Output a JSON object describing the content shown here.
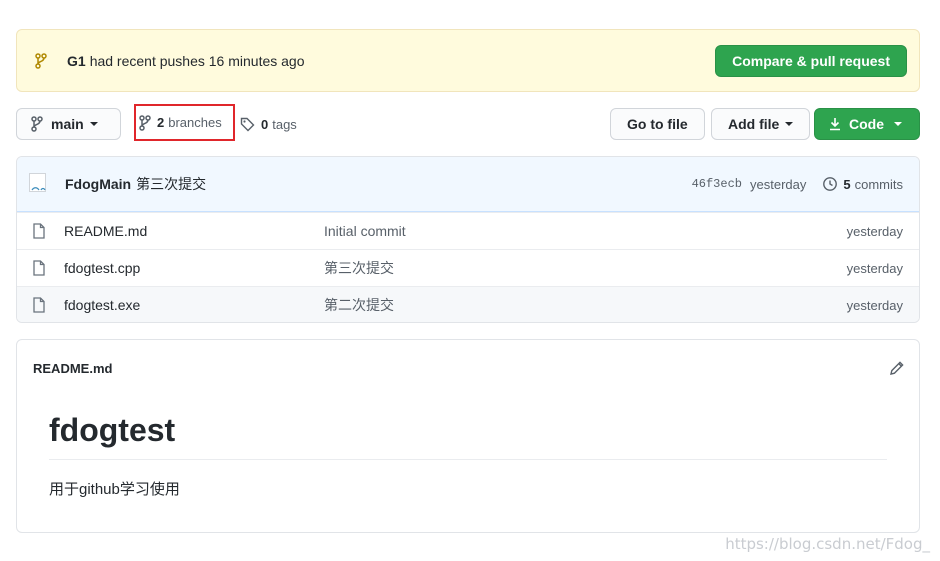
{
  "banner": {
    "branch_name": "G1",
    "message": "had recent pushes 16 minutes ago",
    "compare_button": "Compare & pull request"
  },
  "toolbar": {
    "branch": "main",
    "branches_count": "2",
    "branches_label": "branches",
    "tags_count": "0",
    "tags_label": "tags",
    "goto_file": "Go to file",
    "add_file": "Add file",
    "code": "Code"
  },
  "commit": {
    "author": "FdogMain",
    "message": "第三次提交",
    "sha": "46f3ecb",
    "when": "yesterday",
    "commits_count": "5",
    "commits_label": "commits"
  },
  "files": [
    {
      "name": "README.md",
      "message": "Initial commit",
      "date": "yesterday"
    },
    {
      "name": "fdogtest.cpp",
      "message": "第三次提交",
      "date": "yesterday"
    },
    {
      "name": "fdogtest.exe",
      "message": "第二次提交",
      "date": "yesterday"
    }
  ],
  "readme": {
    "filename": "README.md",
    "title": "fdogtest",
    "body": "用于github学习使用"
  },
  "watermark": "https://blog.csdn.net/Fdog_",
  "colors": {
    "accent_green": "#2ea44f",
    "banner_bg": "#fffbdd",
    "highlight_red": "#e0262b",
    "commit_bg": "#f1f8ff"
  }
}
